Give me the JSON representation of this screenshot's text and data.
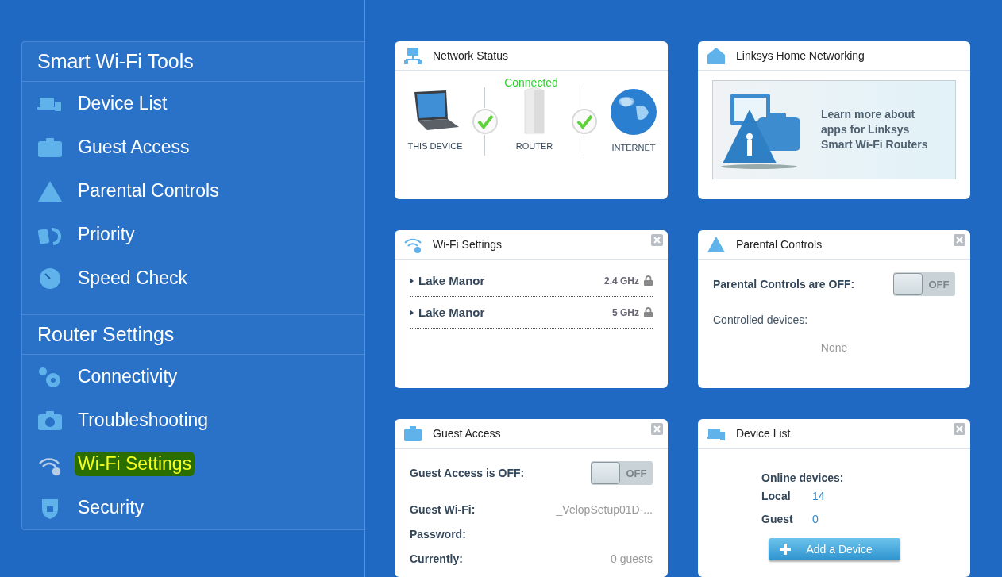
{
  "sidebar": {
    "sections": [
      {
        "title": "Smart Wi-Fi Tools",
        "items": [
          {
            "label": "Device List",
            "highlighted": false
          },
          {
            "label": "Guest Access",
            "highlighted": false
          },
          {
            "label": "Parental Controls",
            "highlighted": false
          },
          {
            "label": "Priority",
            "highlighted": false
          },
          {
            "label": "Speed Check",
            "highlighted": false
          }
        ]
      },
      {
        "title": "Router Settings",
        "items": [
          {
            "label": "Connectivity",
            "highlighted": false
          },
          {
            "label": "Troubleshooting",
            "highlighted": false
          },
          {
            "label": "Wi-Fi Settings",
            "highlighted": true
          },
          {
            "label": "Security",
            "highlighted": false
          }
        ]
      }
    ]
  },
  "widgets": [
    {
      "kind": "network",
      "title": "Network Status",
      "closable": false,
      "status": "Connected",
      "nodes": [
        "THIS DEVICE",
        "ROUTER",
        "INTERNET"
      ],
      "links": [
        {
          "ok": true
        },
        {
          "ok": true
        }
      ]
    },
    {
      "kind": "promo",
      "title": "Linksys Home Networking",
      "closable": false,
      "lines": [
        "Learn more about",
        "apps for Linksys",
        "Smart Wi-Fi Routers"
      ]
    },
    {
      "kind": "wifi",
      "title": "Wi-Fi Settings",
      "closable": true,
      "networks": [
        {
          "name": "Lake Manor",
          "band": "2.4 GHz",
          "locked": true
        },
        {
          "name": "Lake Manor",
          "band": "5 GHz",
          "locked": true
        }
      ]
    },
    {
      "kind": "parental",
      "title": "Parental Controls",
      "closable": true,
      "state_label": "Parental Controls are OFF:",
      "toggle": {
        "on": false,
        "label": "OFF"
      },
      "devices_label": "Controlled devices:",
      "devices_value": "None"
    },
    {
      "kind": "guest",
      "title": "Guest Access",
      "closable": true,
      "state_label": "Guest Access is OFF:",
      "toggle": {
        "on": false,
        "label": "OFF"
      },
      "fields": [
        {
          "label": "Guest Wi-Fi:",
          "value": "_VelopSetup01D-..."
        },
        {
          "label": "Password:"
        },
        {
          "label": "Currently:",
          "value": "0 guests"
        }
      ]
    },
    {
      "kind": "devices",
      "title": "Device List",
      "closable": true,
      "heading": "Online devices:",
      "counts": [
        {
          "label": "Local",
          "value": "14"
        },
        {
          "label": "Guest",
          "value": "0"
        }
      ],
      "button": "Add a Device"
    }
  ]
}
